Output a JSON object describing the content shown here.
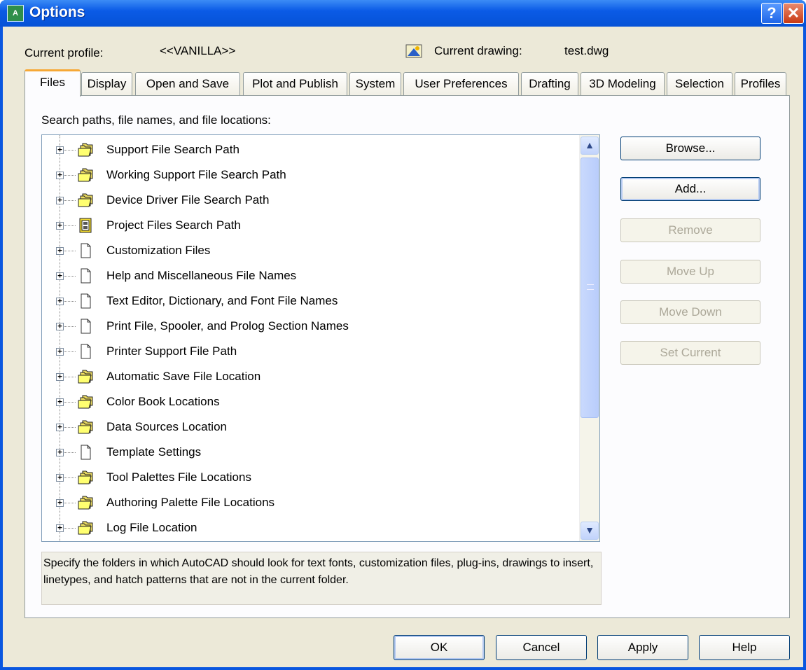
{
  "window": {
    "title": "Options"
  },
  "profile": {
    "label": "Current profile:",
    "value": "<<VANILLA>>"
  },
  "drawing": {
    "label": "Current drawing:",
    "value": "test.dwg"
  },
  "tabs": [
    {
      "label": "Files"
    },
    {
      "label": "Display"
    },
    {
      "label": "Open and Save"
    },
    {
      "label": "Plot and Publish"
    },
    {
      "label": "System"
    },
    {
      "label": "User Preferences"
    },
    {
      "label": "Drafting"
    },
    {
      "label": "3D Modeling"
    },
    {
      "label": "Selection"
    },
    {
      "label": "Profiles"
    }
  ],
  "tree": {
    "caption": "Search paths, file names, and file locations:",
    "items": [
      {
        "label": "Support File Search Path",
        "icon": "folder-multi-icon"
      },
      {
        "label": "Working Support File Search Path",
        "icon": "folder-multi-icon"
      },
      {
        "label": "Device Driver File Search Path",
        "icon": "folder-multi-icon"
      },
      {
        "label": "Project Files Search Path",
        "icon": "project-icon"
      },
      {
        "label": "Customization Files",
        "icon": "file-icon"
      },
      {
        "label": "Help and Miscellaneous File Names",
        "icon": "file-icon"
      },
      {
        "label": "Text Editor, Dictionary, and Font File Names",
        "icon": "file-icon"
      },
      {
        "label": "Print File, Spooler, and Prolog Section Names",
        "icon": "file-icon"
      },
      {
        "label": "Printer Support File Path",
        "icon": "file-icon"
      },
      {
        "label": "Automatic Save File Location",
        "icon": "folder-multi-icon"
      },
      {
        "label": "Color Book Locations",
        "icon": "folder-multi-icon"
      },
      {
        "label": "Data Sources Location",
        "icon": "folder-multi-icon"
      },
      {
        "label": "Template Settings",
        "icon": "file-icon"
      },
      {
        "label": "Tool Palettes File Locations",
        "icon": "folder-multi-icon"
      },
      {
        "label": "Authoring Palette File Locations",
        "icon": "folder-multi-icon"
      },
      {
        "label": "Log File Location",
        "icon": "folder-multi-icon"
      }
    ]
  },
  "side_buttons": {
    "browse": "Browse...",
    "add": "Add...",
    "remove": "Remove",
    "move_up": "Move Up",
    "move_down": "Move Down",
    "set_current": "Set Current"
  },
  "description": "Specify the folders in which AutoCAD should look for text fonts, customization files, plug-ins, drawings to insert, linetypes, and hatch patterns that are not in the current folder.",
  "footer": {
    "ok": "OK",
    "cancel": "Cancel",
    "apply": "Apply",
    "help": "Help"
  },
  "colors": {
    "titlebar": "#0552d6",
    "dialog_bg": "#ece9d8",
    "active_tab_accent": "#f6a836"
  }
}
